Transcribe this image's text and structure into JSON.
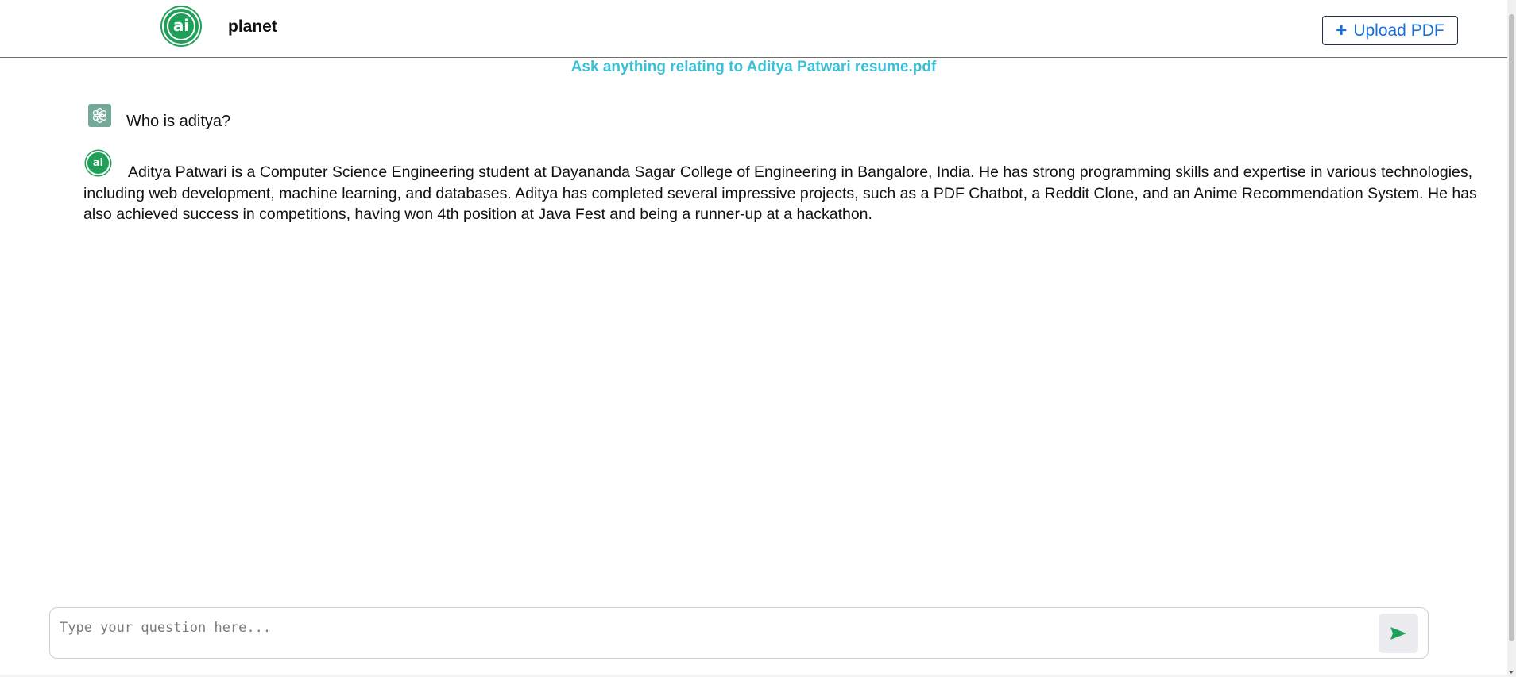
{
  "header": {
    "logo_text": "ai",
    "app_name": "planet",
    "upload_button": {
      "icon": "plus-icon",
      "label": "Upload PDF"
    }
  },
  "subtitle": "Ask anything relating to Aditya Patwari resume.pdf",
  "chat": {
    "messages": [
      {
        "role": "user",
        "avatar_icon": "openai-icon",
        "text": "Who is aditya?"
      },
      {
        "role": "assistant",
        "avatar_text": "ai",
        "text": "Aditya Patwari is a Computer Science Engineering student at Dayananda Sagar College of Engineering in Bangalore, India. He has strong programming skills and expertise in various technologies, including web development, machine learning, and databases. Aditya has completed several impressive projects, such as a PDF Chatbot, a Reddit Clone, and an Anime Recommendation System. He has also achieved success in competitions, having won 4th position at Java Fest and being a runner-up at a hackathon."
      }
    ]
  },
  "composer": {
    "placeholder": "Type your question here...",
    "value": "",
    "send_icon": "send-icon"
  },
  "colors": {
    "brand_green": "#1fa058",
    "subtitle_cyan": "#3cc0d8",
    "upload_blue": "#1670d8",
    "user_avatar": "#74a99a"
  }
}
